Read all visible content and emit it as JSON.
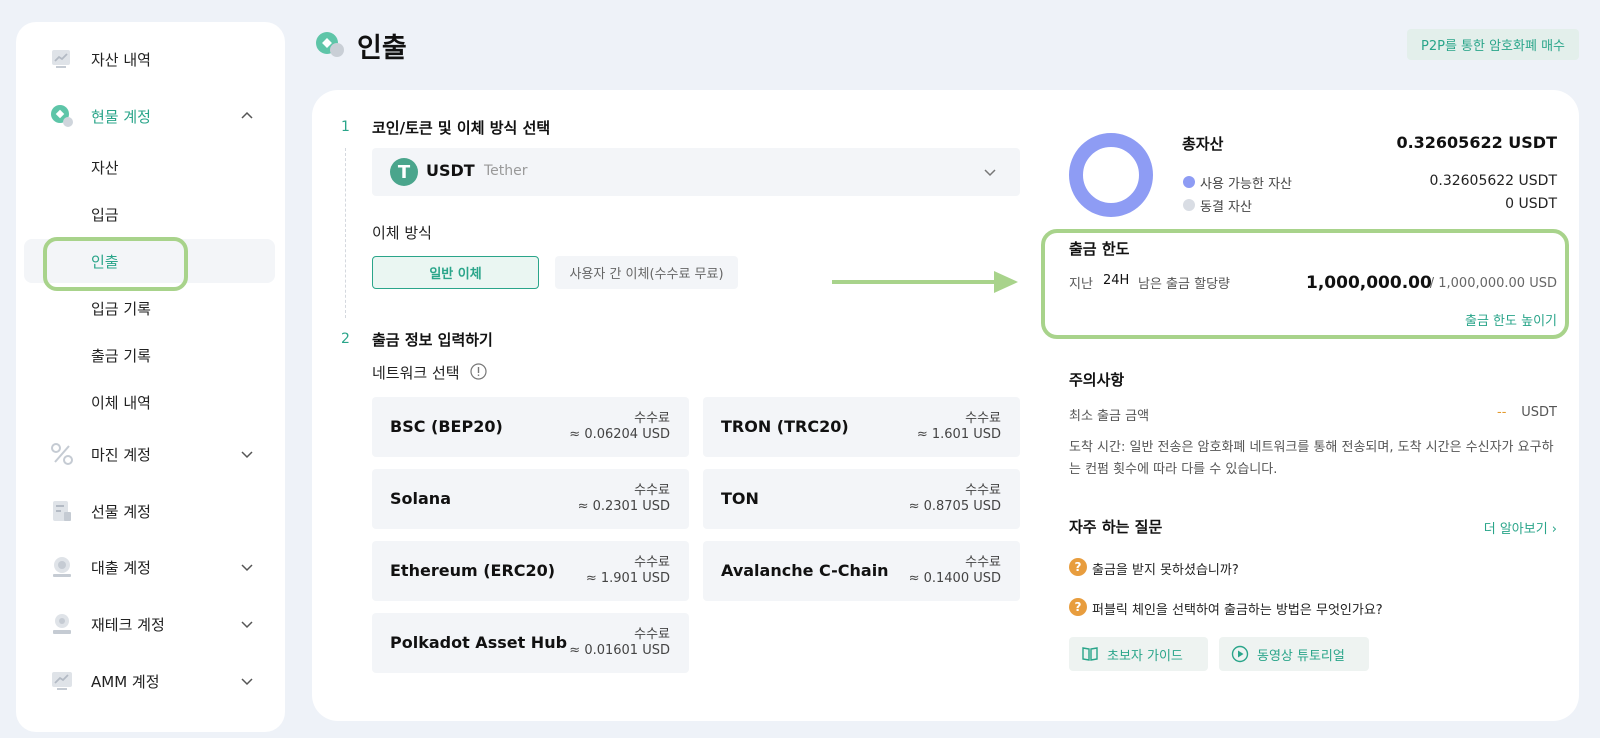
{
  "sidebar": {
    "items": [
      {
        "label": "자산 내역"
      },
      {
        "label": "현물 계정"
      },
      {
        "label": "마진 계정"
      },
      {
        "label": "선물 계정"
      },
      {
        "label": "대출 계정"
      },
      {
        "label": "재테크 계정"
      },
      {
        "label": "AMM 계정"
      }
    ],
    "sub_items": [
      {
        "label": "자산"
      },
      {
        "label": "입금"
      },
      {
        "label": "인출"
      },
      {
        "label": "입금 기록"
      },
      {
        "label": "출금 기록"
      },
      {
        "label": "이체 내역"
      }
    ]
  },
  "header": {
    "title": "인출",
    "p2p_button": "P2P를 통한 암호화폐 매수"
  },
  "steps": {
    "step1_num": "1",
    "step1_title": "코인/토큰 및 이체 방식 선택",
    "step2_num": "2",
    "step2_title": "출금 정보 입력하기"
  },
  "coin": {
    "symbol": "USDT",
    "name": "Tether",
    "logo_glyph": "T"
  },
  "transfer": {
    "label": "이체 방식",
    "general": "일반 이체",
    "p2p": "사용자 간 이체(수수료 무료)"
  },
  "network": {
    "label": "네트워크 선택",
    "fee_label": "수수료",
    "options": [
      {
        "name": "BSC (BEP20)",
        "fee": "≈ 0.06204 USD"
      },
      {
        "name": "TRON (TRC20)",
        "fee": "≈ 1.601 USD"
      },
      {
        "name": "Solana",
        "fee": "≈ 0.2301 USD"
      },
      {
        "name": "TON",
        "fee": "≈ 0.8705 USD"
      },
      {
        "name": "Ethereum (ERC20)",
        "fee": "≈ 1.901 USD"
      },
      {
        "name": "Avalanche C-Chain",
        "fee": "≈ 0.1400 USD"
      },
      {
        "name": "Polkadot Asset Hub",
        "fee": "≈ 0.01601 USD"
      }
    ]
  },
  "assets": {
    "total_label": "총자산",
    "total_value": "0.32605622 USDT",
    "available_label": "사용 가능한 자산",
    "available_value": "0.32605622 USDT",
    "frozen_label": "동결 자산",
    "frozen_value": "0 USDT",
    "available_color": "#8e9cf4",
    "frozen_color": "#d9dde4"
  },
  "limit": {
    "title": "출금 한도",
    "past": "지난",
    "period": "24H",
    "remain_label": "남은 출금 할당량",
    "remaining": "1,000,000.00",
    "total": "/  1,000,000.00 USD",
    "raise": "출금 한도 높이기"
  },
  "notes": {
    "title": "주의사항",
    "min_label": "최소 출금 금액",
    "min_value": "--",
    "min_unit": "USDT",
    "arrival": "도착 시간: 일반 전송은 암호화폐 네트워크를 통해 전송되며, 도착 시간은 수신자가 요구하는 컨펌 횟수에 따라 다를 수 있습니다."
  },
  "faq": {
    "title": "자주 하는 질문",
    "more": "더 알아보기 ›",
    "q1": "출금을 받지 못하셨습니까?",
    "q2": "퍼블릭 체인을 선택하여 출금하는 방법은 무엇인가요?",
    "q_glyph": "?",
    "guide": "초보자 가이드",
    "video": "동영상 튜토리얼"
  },
  "colors": {
    "accent": "#2aa58a",
    "highlight": "#a8d38b",
    "warning": "#e89d3e"
  }
}
